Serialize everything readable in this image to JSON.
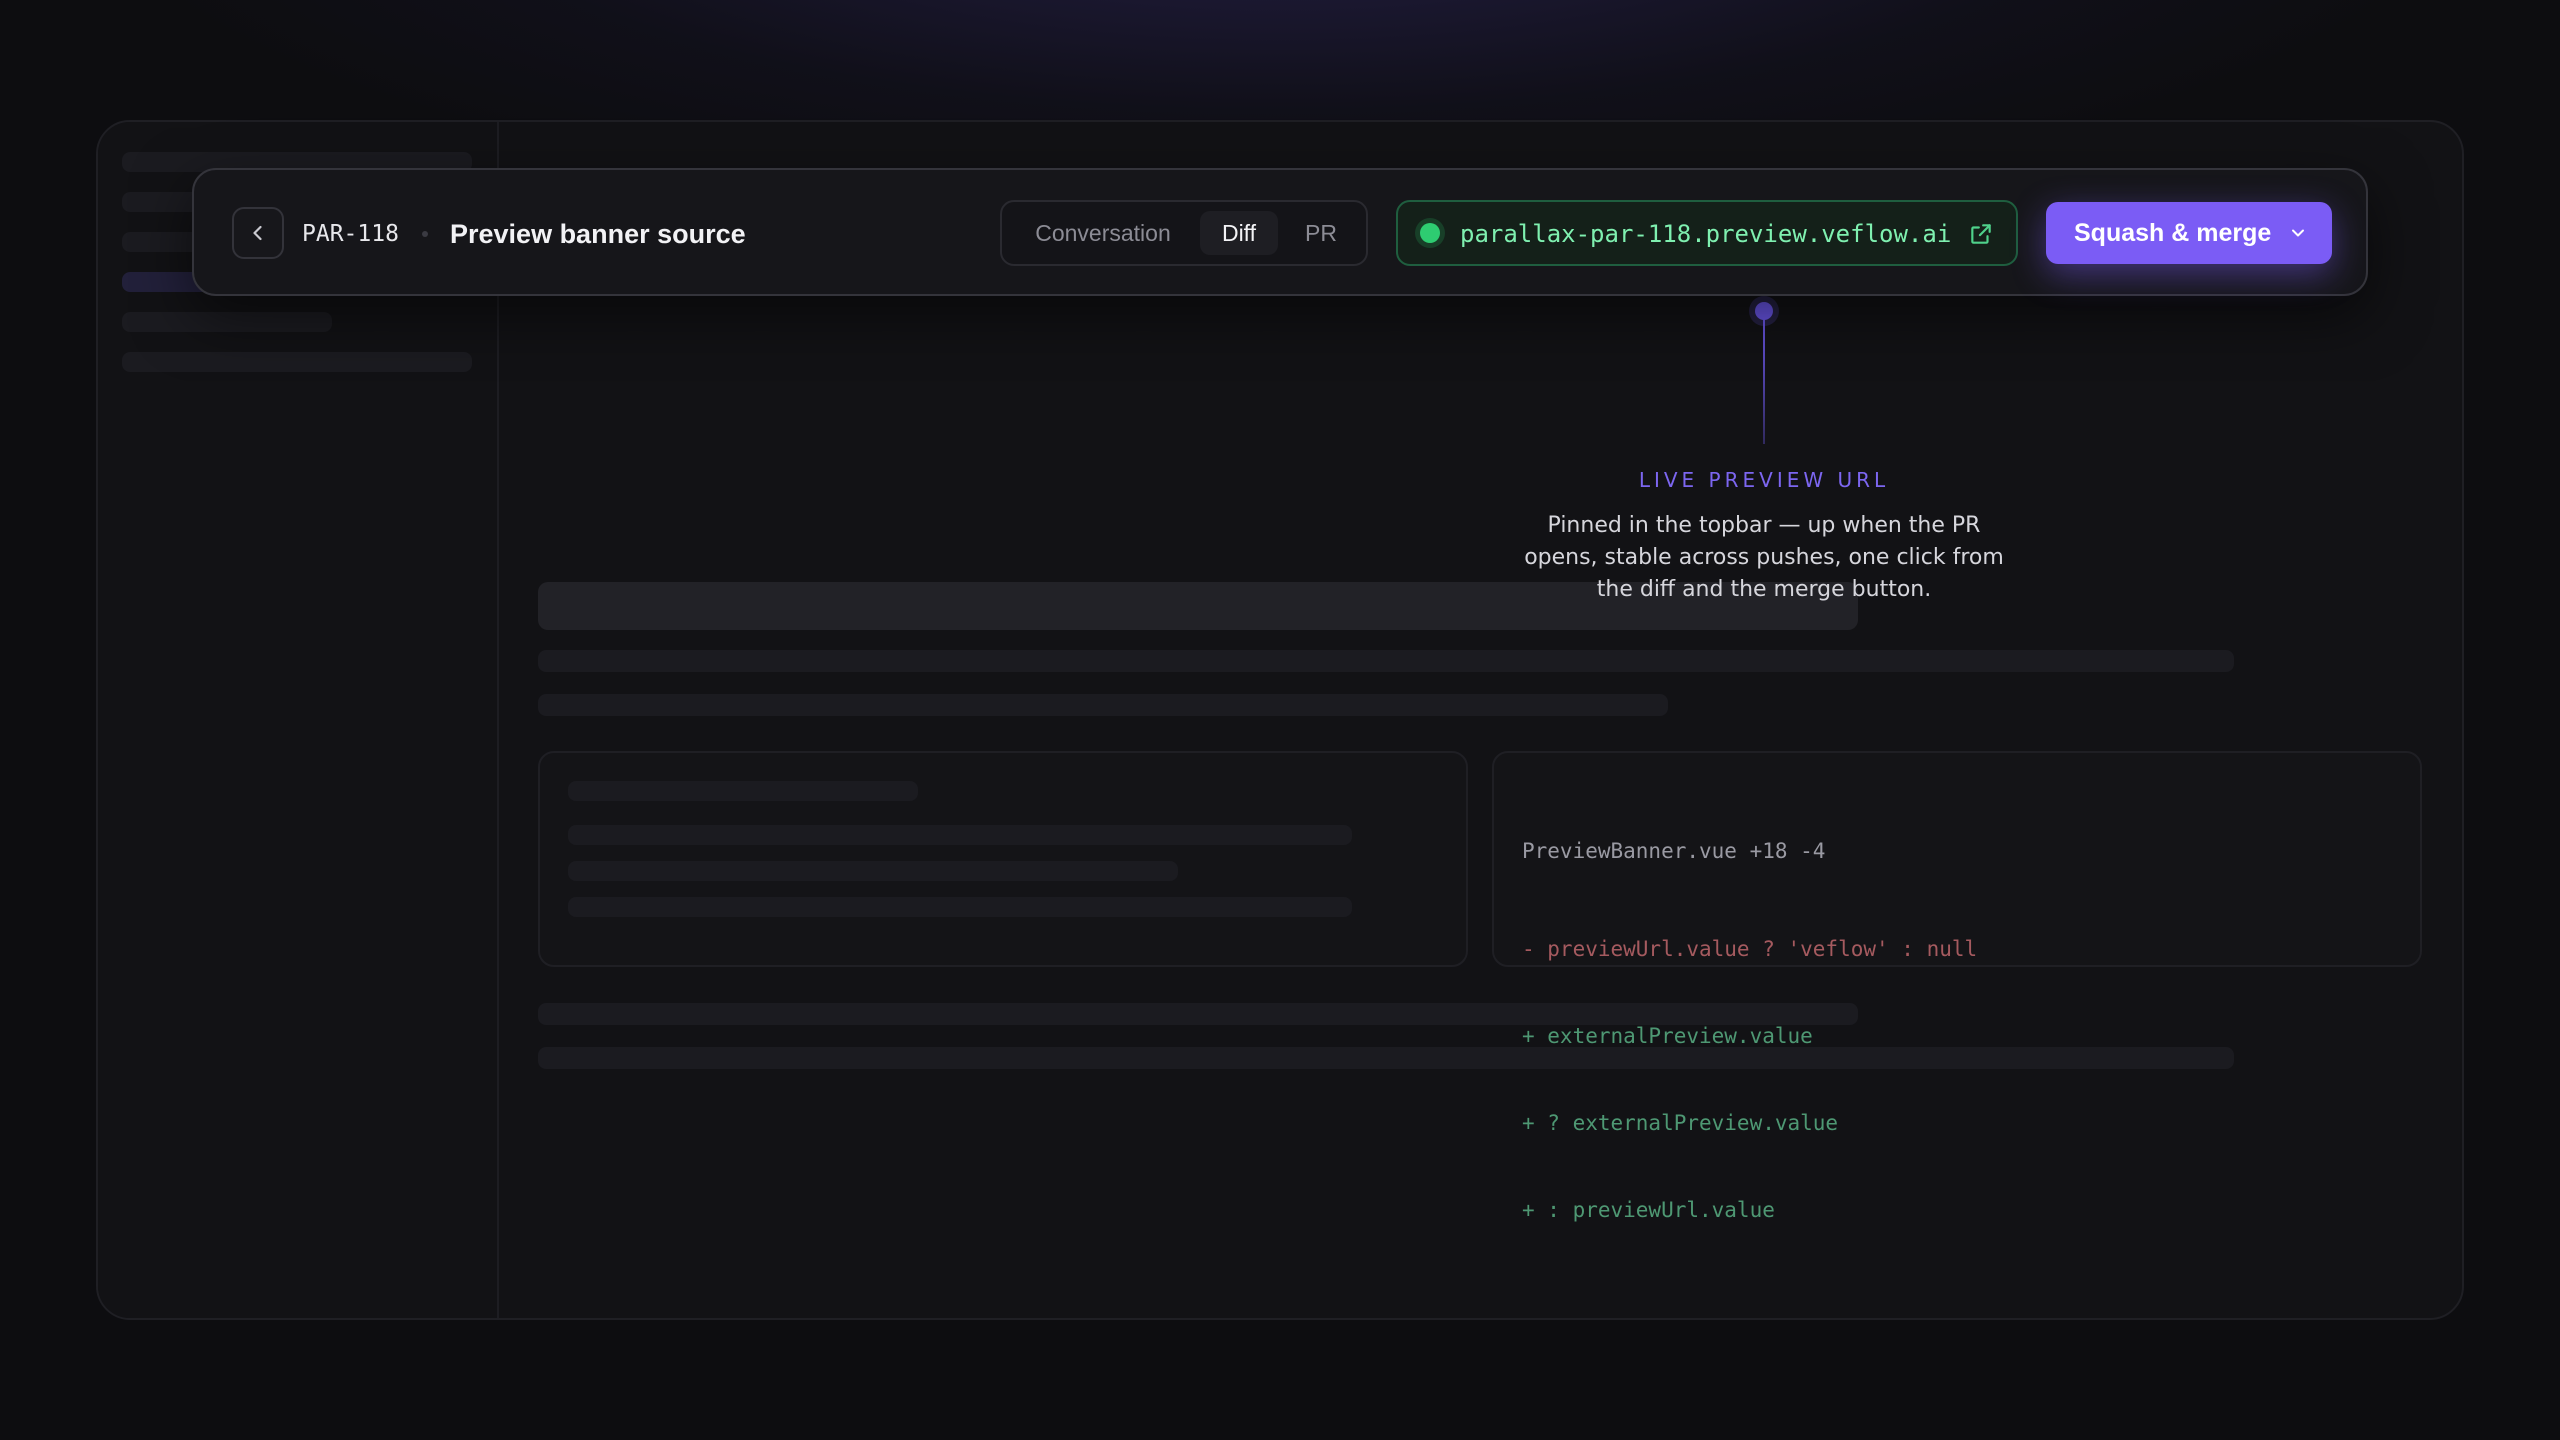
{
  "topbar": {
    "issue_id": "PAR-118",
    "title": "Preview banner source",
    "tabs": [
      {
        "label": "Conversation",
        "active": false
      },
      {
        "label": "Diff",
        "active": true
      },
      {
        "label": "PR",
        "active": false
      }
    ],
    "preview": {
      "url": "parallax-par-118.preview.veflow.ai",
      "status_color": "#2ecc71"
    },
    "merge_button": {
      "label": "Squash & merge",
      "color": "#7b5cf5"
    }
  },
  "annotation": {
    "heading": "LIVE PREVIEW URL",
    "body": "Pinned in the topbar — up when the PR opens, stable across pushes, one click from the diff and the merge button.",
    "accent": "#6a56e8"
  },
  "diff": {
    "file_header": "PreviewBanner.vue +18 -4",
    "lines": [
      {
        "type": "del",
        "text": "- previewUrl.value ? 'veflow' : null"
      },
      {
        "type": "add",
        "text": "+ externalPreview.value"
      },
      {
        "type": "add",
        "text": "+ ? externalPreview.value"
      },
      {
        "type": "add",
        "text": "+ : previewUrl.value"
      }
    ]
  },
  "icons": {
    "back": "chevron-left-icon",
    "external": "external-link-icon",
    "dropdown": "chevron-down-icon"
  }
}
